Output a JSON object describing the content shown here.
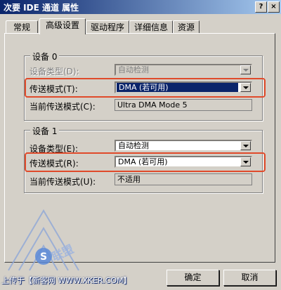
{
  "window": {
    "title": "次要 IDE 通道 属性",
    "help_btn": "?",
    "close_btn": "×"
  },
  "tabs": [
    "常规",
    "高级设置",
    "驱动程序",
    "详细信息",
    "资源"
  ],
  "device0": {
    "group_label": "设备 0",
    "type_label": "设备类型(D):",
    "type_value": "自动检测",
    "mode_label": "传送模式(T):",
    "mode_value": "DMA (若可用)",
    "current_label": "当前传送模式(C):",
    "current_value": "Ultra DMA Mode 5"
  },
  "device1": {
    "group_label": "设备 1",
    "type_label": "设备类型(E):",
    "type_value": "自动检测",
    "mode_label": "传送模式(R):",
    "mode_value": "DMA (若可用)",
    "current_label": "当前传送模式(U):",
    "current_value": "不适用"
  },
  "buttons": {
    "ok": "确定",
    "cancel": "取消"
  },
  "watermark": {
    "text": "上传于【新客网 WWW.XKER.COM】"
  },
  "colors": {
    "highlight_box": "#e04a2a",
    "title_start": "#0a246a",
    "title_end": "#a6caf0"
  }
}
